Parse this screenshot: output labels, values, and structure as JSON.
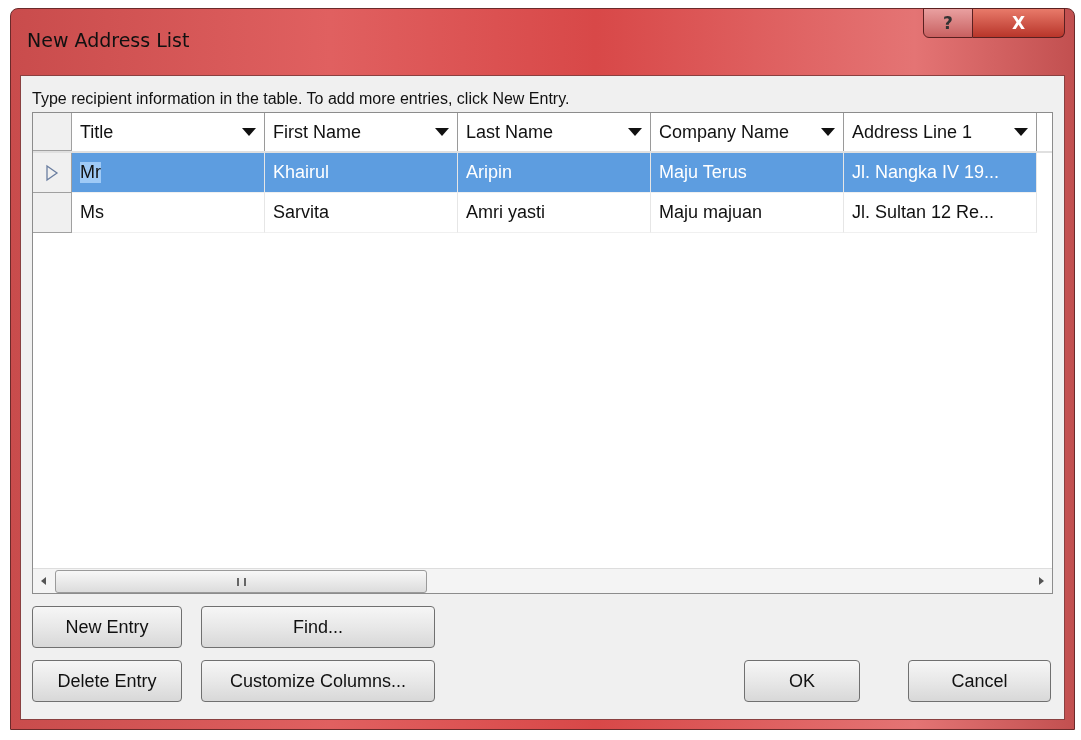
{
  "window": {
    "title": "New Address List"
  },
  "title_buttons": [
    {
      "kind": "help",
      "label": "?"
    },
    {
      "kind": "close",
      "label": "X"
    }
  ],
  "instruction": "Type recipient information in the table.  To add more entries, click New Entry.",
  "table": {
    "columns": [
      "Title",
      "First Name",
      "Last Name",
      "Company Name",
      "Address Line 1"
    ],
    "rows": [
      {
        "selected": true,
        "cells": [
          "Mr",
          "Khairul",
          "Aripin",
          "Maju Terus",
          "Jl. Nangka IV 19..."
        ]
      },
      {
        "selected": false,
        "cells": [
          "Ms",
          "Sarvita",
          "Amri yasti",
          "Maju majuan",
          "Jl. Sultan 12 Re..."
        ]
      }
    ]
  },
  "buttons": [
    {
      "label": "New Entry",
      "kind": "left"
    },
    {
      "label": "Find...",
      "kind": "left"
    },
    {
      "label": "Delete Entry",
      "kind": "left"
    },
    {
      "label": "Customize Columns...",
      "kind": "left"
    },
    {
      "label": "OK",
      "kind": "right"
    },
    {
      "label": "Cancel",
      "kind": "right"
    }
  ]
}
